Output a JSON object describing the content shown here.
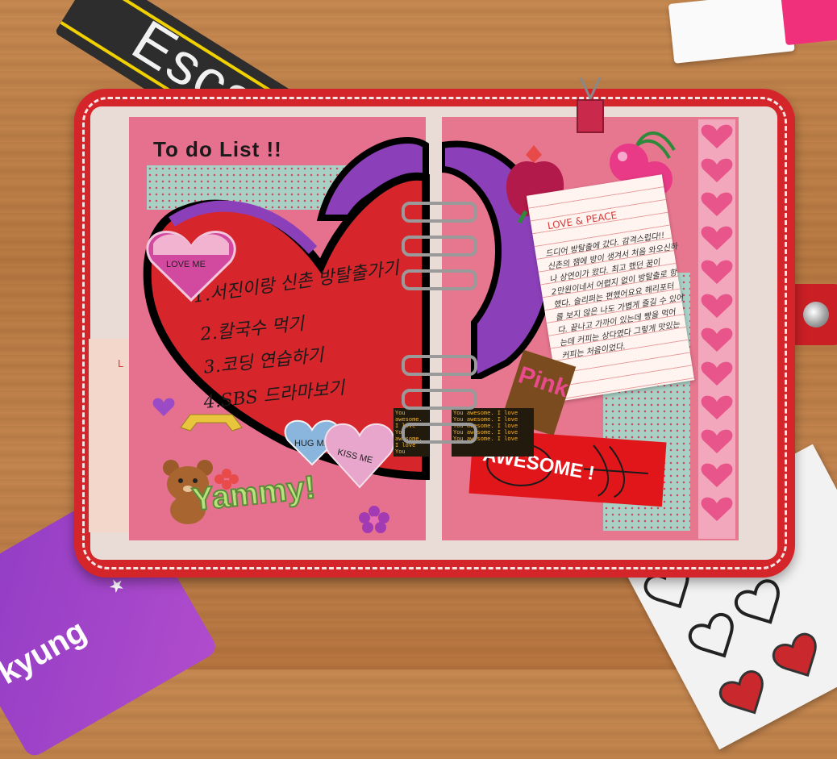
{
  "desk": {
    "dark_card_text": "Escape",
    "purple_card_text": "kyung"
  },
  "left_page": {
    "title": "To do List !!",
    "items": [
      "1.서진이랑 신촌 방탈출가기",
      "2.칼국수 먹기",
      "3.코딩 연습하기",
      "4.SBS 드라마보기"
    ],
    "love_me_label": "LOVE ME",
    "hug_me_label": "HUG ME",
    "kiss_me_label": "KISS ME",
    "sticker_text": "Yammy!",
    "side_note_letter": "L"
  },
  "right_page": {
    "note_title": "LOVE & PEACE",
    "note_lines": [
      "드디어 방탈출에 갔다. 감격스럽다!!",
      "신촌의 잼에 방이 생겨서 처음 와오신하",
      "나 상연이가 왔다. 최고 했던 꿈이",
      "2만원이네서 어렵지 없이 방탈출로 항",
      "했다. 슬리퍼는 편했어요요 해리포터",
      "를 보지 않은 나도 가볍게 즐길 수 있어",
      "다. 끝나고 가까이 있는데 빵을 먹어",
      "는데 커피는 상다였다 그렇게 맛있는",
      "커피는 처음이었다."
    ],
    "pink_label": "Pink",
    "awesome_label": "AWESOME !"
  },
  "tape_text": "You awesome. I love",
  "colors": {
    "planner_red": "#d4262a",
    "page_pink": "#e5718f",
    "heart_red": "#d6262c",
    "heart_purple": "#8b3fb8"
  }
}
